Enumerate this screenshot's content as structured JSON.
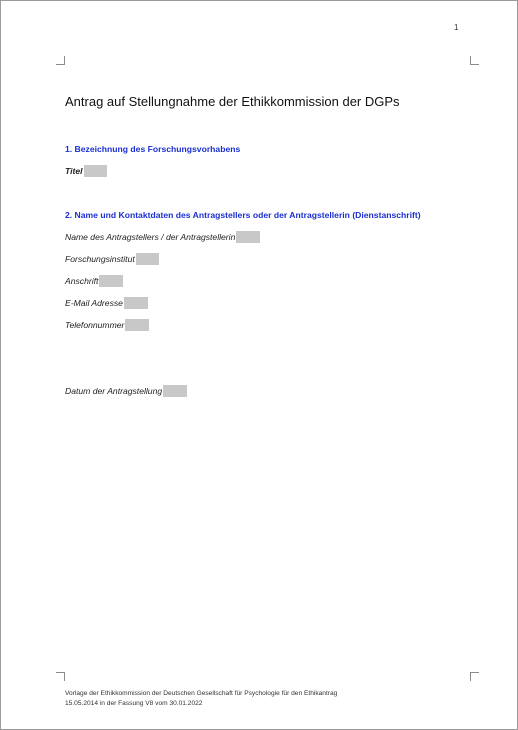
{
  "page_number": "1",
  "title": "Antrag auf Stellungnahme der Ethikkommission der DGPs",
  "section1": {
    "heading": "1. Bezeichnung des Forschungsvorhabens",
    "fields": [
      {
        "label": "Titel"
      }
    ]
  },
  "section2": {
    "heading": "2. Name und Kontaktdaten des Antragstellers oder der Antragstellerin (Dienstanschrift)",
    "fields": [
      {
        "label": "Name des Antragstellers / der Antragstellerin"
      },
      {
        "label": "Forschungsinstitut"
      },
      {
        "label": "Anschrift"
      },
      {
        "label": "E-Mail Adresse"
      },
      {
        "label": "Telefonnummer"
      }
    ]
  },
  "date_field": {
    "label": "Datum der Antragstellung"
  },
  "footer": {
    "line1": "Vorlage der Ethikkommission der Deutschen Gesellschaft für Psychologie für den Ethikantrag",
    "line2": "15.05.2014 in der Fassung V8 vom 30.01.2022"
  },
  "colors": {
    "heading": "#1a2fcf",
    "field_fill": "#c8c8c8"
  }
}
